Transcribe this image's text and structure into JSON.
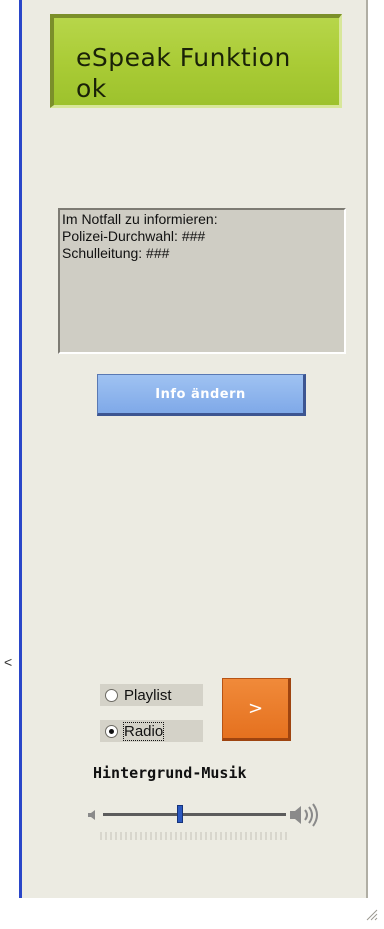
{
  "display": {
    "line1": "eSpeak Funktion",
    "line2": "ok",
    "bg_color": "#a9cb35"
  },
  "info": {
    "lines": [
      "Im Notfall zu informieren:",
      "Polizei-Durchwahl: ###",
      "Schulleitung: ###"
    ]
  },
  "buttons": {
    "info_change": "Info ändern",
    "play": ">"
  },
  "music": {
    "options": [
      {
        "label": "Playlist",
        "checked": false
      },
      {
        "label": "Radio",
        "checked": true
      }
    ],
    "label": "Hintergrund-Musik",
    "volume": 0.42
  },
  "stray_mark": "<",
  "colors": {
    "accent_blue": "#2a46c8",
    "button_blue": "#7fa9e8",
    "button_orange": "#e5711f"
  }
}
